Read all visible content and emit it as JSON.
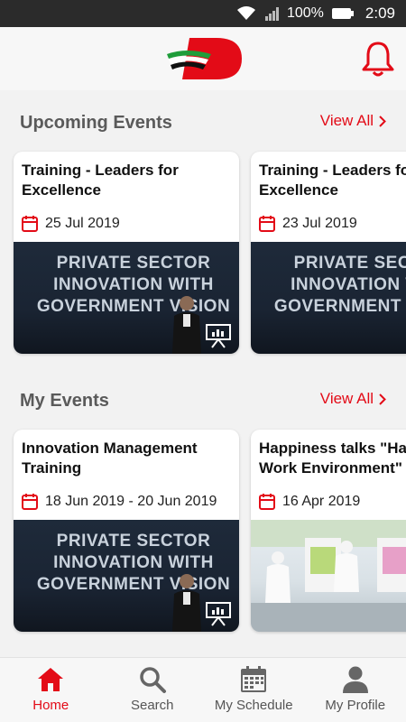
{
  "status_bar": {
    "battery": "100%",
    "time": "2:09"
  },
  "colors": {
    "accent": "#e30b17",
    "nav_inactive": "#555555"
  },
  "header": {
    "logo_icon": "uae-logo",
    "bell_icon": "bell-icon"
  },
  "upcoming": {
    "title": "Upcoming Events",
    "view_all": "View All",
    "cards": [
      {
        "title": "Training - Leaders for\nExcellence",
        "date": "25 Jul 2019",
        "banner": "PRIVATE SECTOR\nINNOVATION WITH\nGOVERNMENT VISION"
      },
      {
        "title": "Training - Leaders for\nExcellence",
        "date": "23 Jul 2019",
        "banner": "PRIVATE SECTOR\nINNOVATION WITH\nGOVERNMENT VISION"
      }
    ]
  },
  "my_events": {
    "title": "My Events",
    "view_all": "View All",
    "cards": [
      {
        "title": "Innovation Management\nTraining",
        "date": "18 Jun 2019 - 20 Jun 2019",
        "banner": "PRIVATE SECTOR\nINNOVATION WITH\nGOVERNMENT VISION"
      },
      {
        "title": "Happiness talks \"Happy\nWork Environment\"",
        "date": "16 Apr 2019"
      }
    ]
  },
  "nav": {
    "items": [
      {
        "label": "Home",
        "icon": "home-icon"
      },
      {
        "label": "Search",
        "icon": "search-icon"
      },
      {
        "label": "My Schedule",
        "icon": "calendar-icon"
      },
      {
        "label": "My Profile",
        "icon": "profile-icon"
      }
    ]
  }
}
